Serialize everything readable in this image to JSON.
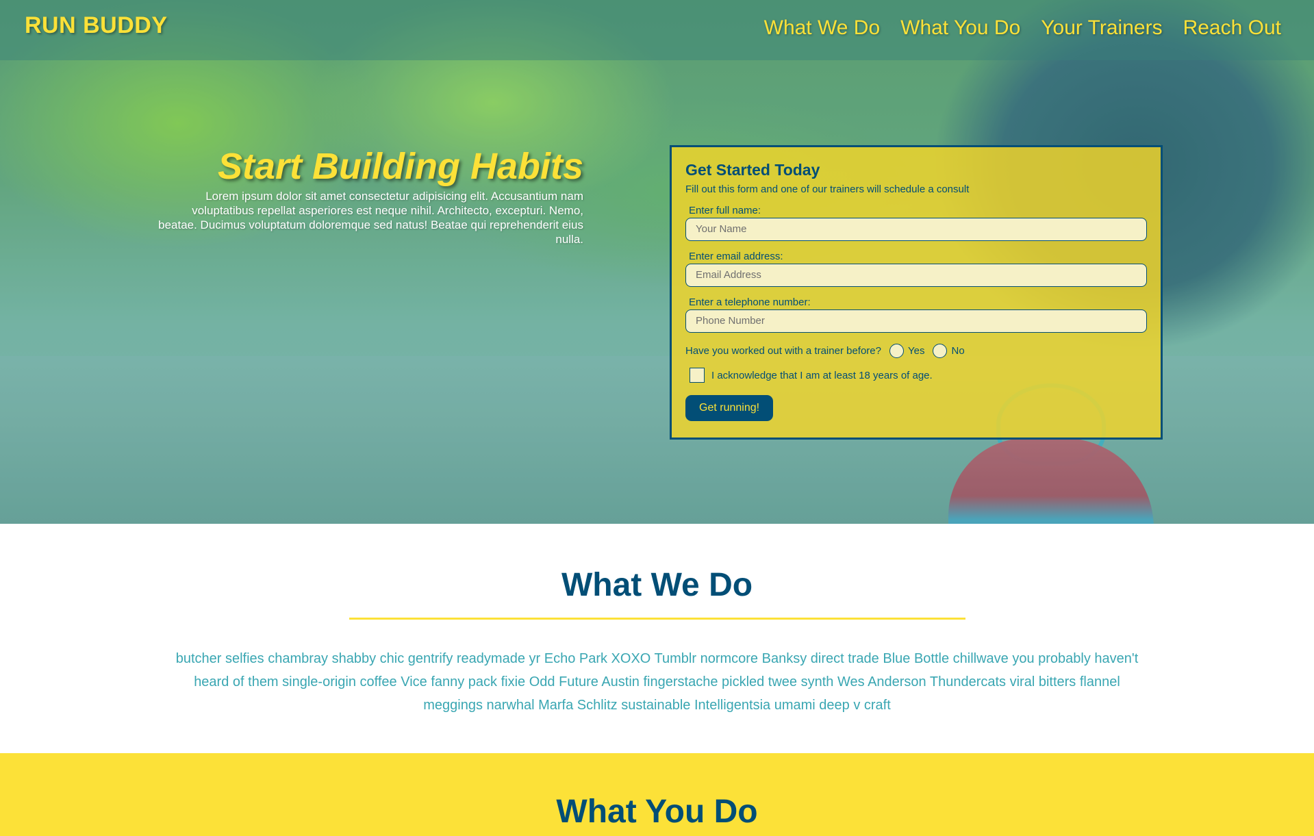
{
  "header": {
    "logo": "RUN BUDDY",
    "nav": [
      "What We Do",
      "What You Do",
      "Your Trainers",
      "Reach Out"
    ]
  },
  "hero": {
    "title": "Start Building Habits",
    "body": "Lorem ipsum dolor sit amet consectetur adipisicing elit. Accusantium nam voluptatibus repellat asperiores est neque nihil. Architecto, excepturi. Nemo, beatae. Ducimus voluptatum doloremque sed natus! Beatae qui reprehenderit eius nulla."
  },
  "form": {
    "title": "Get Started Today",
    "subtitle": "Fill out this form and one of our trainers will schedule a consult",
    "name_label": "Enter full name:",
    "name_placeholder": "Your Name",
    "email_label": "Enter email address:",
    "email_placeholder": "Email Address",
    "phone_label": "Enter a telephone number:",
    "phone_placeholder": "Phone Number",
    "trainer_question": "Have you worked out with a trainer before?",
    "yes": "Yes",
    "no": "No",
    "acknowledge": "I acknowledge that I am at least 18 years of age.",
    "submit": "Get running!"
  },
  "what_we_do": {
    "title": "What We Do",
    "body": "butcher selfies chambray shabby chic gentrify readymade yr Echo Park XOXO Tumblr normcore Banksy direct trade Blue Bottle chillwave you probably haven't heard of them single-origin coffee Vice fanny pack fixie Odd Future Austin fingerstache pickled twee synth Wes Anderson Thundercats viral bitters flannel meggings narwhal Marfa Schlitz sustainable Intelligentsia umami deep v craft"
  },
  "what_you_do": {
    "title": "What You Do"
  },
  "colors": {
    "primary": "#024e76",
    "accent": "#fce138",
    "text_teal": "#39a6b2"
  }
}
